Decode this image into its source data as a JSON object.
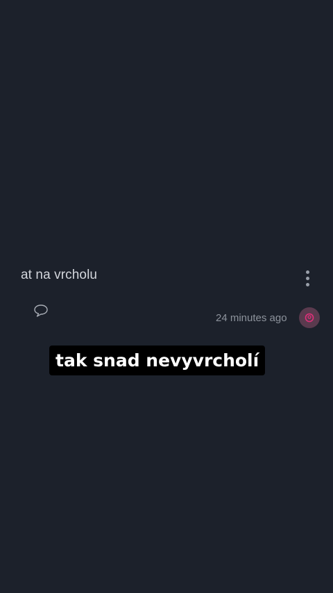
{
  "post": {
    "text": "at na vrcholu",
    "timestamp": "24 minutes ago"
  },
  "icons": {
    "more": "more-vertical-icon",
    "comment": "comment-bubble-icon",
    "avatar": "user-avatar-icon"
  },
  "caption": {
    "text": "tak snad nevyvrcholí"
  },
  "colors": {
    "background": "#1c212b",
    "text": "#d3d6dc",
    "muted": "#8d939c",
    "avatar_bg": "#5a3a4e",
    "avatar_fg": "#e0307a",
    "caption_bg": "#000000",
    "caption_fg": "#ffffff"
  }
}
